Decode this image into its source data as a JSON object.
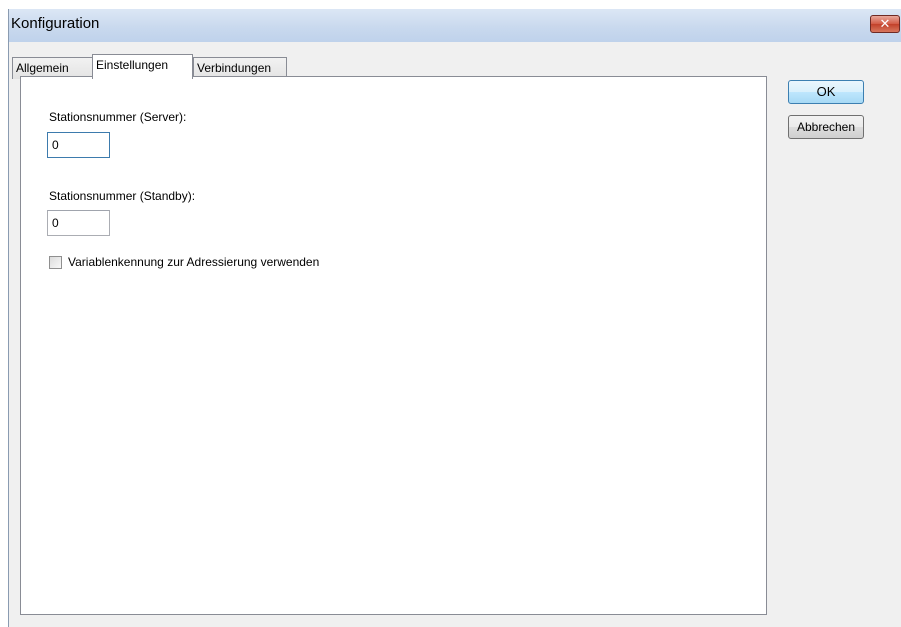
{
  "window": {
    "title": "Konfiguration",
    "close_glyph": "✕"
  },
  "tabs": [
    {
      "label": "Allgemein",
      "active": false
    },
    {
      "label": "Einstellungen",
      "active": true
    },
    {
      "label": "Verbindungen",
      "active": false
    }
  ],
  "settings": {
    "server_station_label": "Stationsnummer (Server):",
    "server_station_value": "0",
    "standby_station_label": "Stationsnummer (Standby):",
    "standby_station_value": "0",
    "use_variable_id_label": "Variablenkennung zur Adressierung verwenden",
    "use_variable_id_checked": false
  },
  "buttons": {
    "ok_label": "OK",
    "cancel_label": "Abbrechen"
  },
  "colors": {
    "titlebar": "#c9d9ee",
    "close_button": "#c2412a",
    "default_button": "#bee6fd",
    "focus_border": "#3d7bad"
  }
}
